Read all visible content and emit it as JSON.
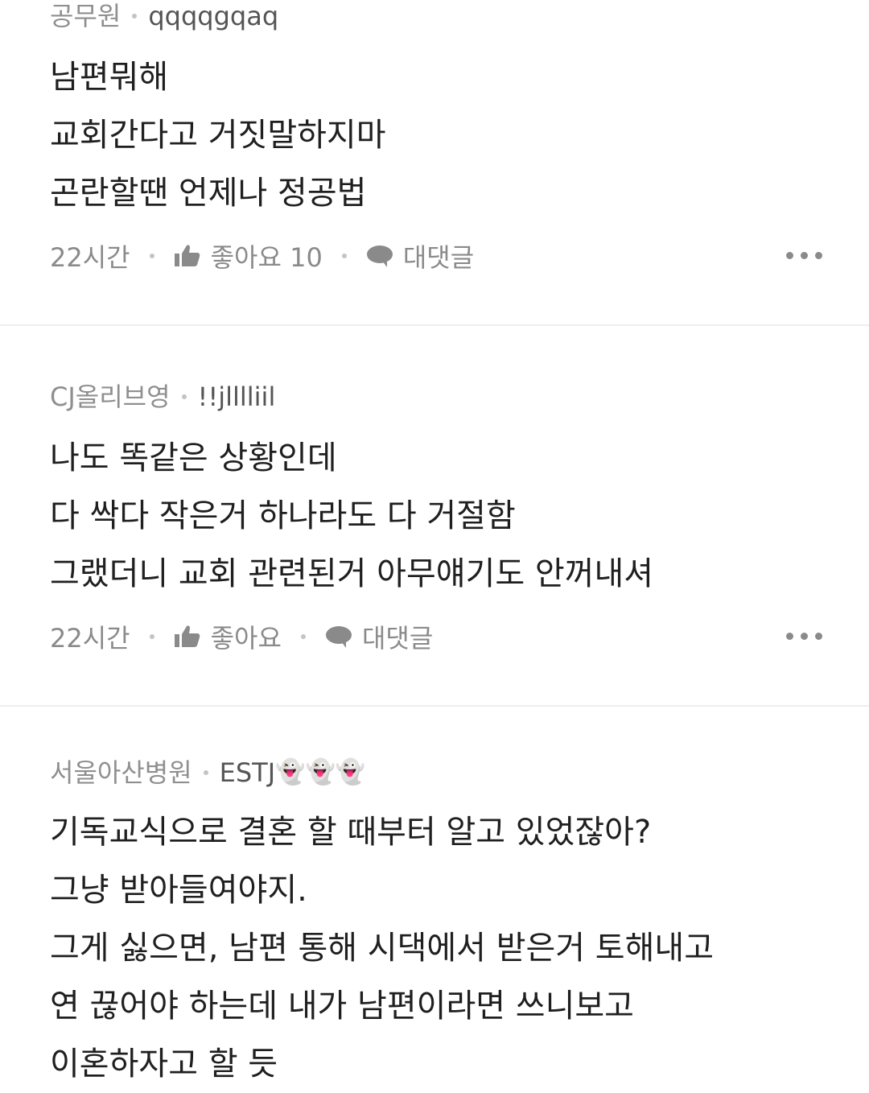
{
  "comments": [
    {
      "company": "공무원",
      "nickname": "qqqqgqaq",
      "lines": [
        "남편뭐해",
        "교회간다고 거짓말하지마",
        "곤란할땐 언제나 정공법"
      ],
      "time": "22시간",
      "like_label": "좋아요 10",
      "reply_label": "대댓글"
    },
    {
      "company": "CJ올리브영",
      "nickname": "!!jlllliil",
      "lines": [
        "나도 똑같은 상황인데",
        "다 싹다 작은거 하나라도 다 거절함",
        "그랬더니 교회 관련된거 아무얘기도 안꺼내셔"
      ],
      "time": "22시간",
      "like_label": "좋아요",
      "reply_label": "대댓글"
    },
    {
      "company": "서울아산병원",
      "nickname": "ESTJ",
      "nickname_emoji": "👻👻👻",
      "lines": [
        "기독교식으로 결혼 할 때부터 알고 있었잖아?",
        "그냥 받아들여야지.",
        "그게 싫으면, 남편 통해 시댁에서 받은거 토해내고",
        "연 끊어야 하는데 내가 남편이라면 쓰니보고",
        "이혼하자고 할 듯"
      ]
    }
  ],
  "icons": {
    "like": "thumbs-up-icon",
    "reply": "speech-bubble-icon",
    "more": "more-horizontal-icon"
  },
  "colors": {
    "meta_text": "#8a8a8a",
    "body_text": "#1f1f1f",
    "divider": "#eeeeee"
  }
}
